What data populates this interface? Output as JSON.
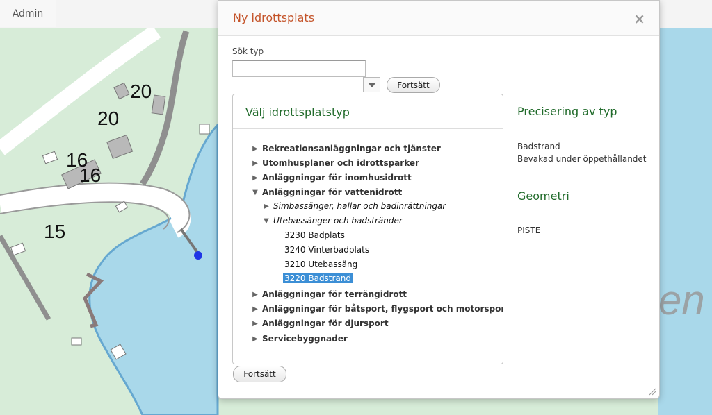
{
  "app": {
    "admin_tab": "Admin"
  },
  "map": {
    "numbers": [
      "20",
      "20",
      "16",
      "16",
      "15"
    ],
    "partial_label": "en"
  },
  "dialog": {
    "title": "Ny idrottsplats",
    "close_icon": "close-icon",
    "search": {
      "label": "Sök typ",
      "value": "",
      "placeholder": "",
      "select_value": ""
    },
    "continue_label": "Fortsätt",
    "tree_panel": {
      "title": "Välj idrottsplatstyp",
      "items": [
        {
          "label": "Rekreationsanläggningar och tjänster",
          "level": 0,
          "expanded": false
        },
        {
          "label": "Utomhusplaner och idrottsparker",
          "level": 0,
          "expanded": false
        },
        {
          "label": "Anläggningar för inomhusidrott",
          "level": 0,
          "expanded": false
        },
        {
          "label": "Anläggningar för vattenidrott",
          "level": 0,
          "expanded": true
        },
        {
          "label": "Simbassänger, hallar och badinrättningar",
          "level": 1,
          "expanded": false
        },
        {
          "label": "Utebassänger och badstränder",
          "level": 1,
          "expanded": true
        },
        {
          "label": "3230 Badplats",
          "level": 2
        },
        {
          "label": "3240 Vinterbadplats",
          "level": 2
        },
        {
          "label": "3210 Utebassäng",
          "level": 2
        },
        {
          "label": "3220 Badstrand",
          "level": 2,
          "selected": true
        },
        {
          "label": "Anläggningar för terrängidrott",
          "level": 0,
          "expanded": false
        },
        {
          "label": "Anläggningar för båtsport, flygsport och motorsport",
          "level": 0,
          "expanded": false
        },
        {
          "label": "Anläggningar för djursport",
          "level": 0,
          "expanded": false
        },
        {
          "label": "Servicebyggnader",
          "level": 0,
          "expanded": false
        }
      ]
    },
    "precision": {
      "title": "Precisering av typ",
      "lines": [
        "Badstrand",
        "Bevakad under öppethållandet"
      ]
    },
    "geometry": {
      "title": "Geometri",
      "value": "PISTE"
    }
  },
  "colors": {
    "accent_title": "#c4542a",
    "section_title": "#216b2b",
    "selected_bg": "#3c8fd6",
    "map_green": "#d7ecd8",
    "map_water": "#a9d8ea"
  }
}
